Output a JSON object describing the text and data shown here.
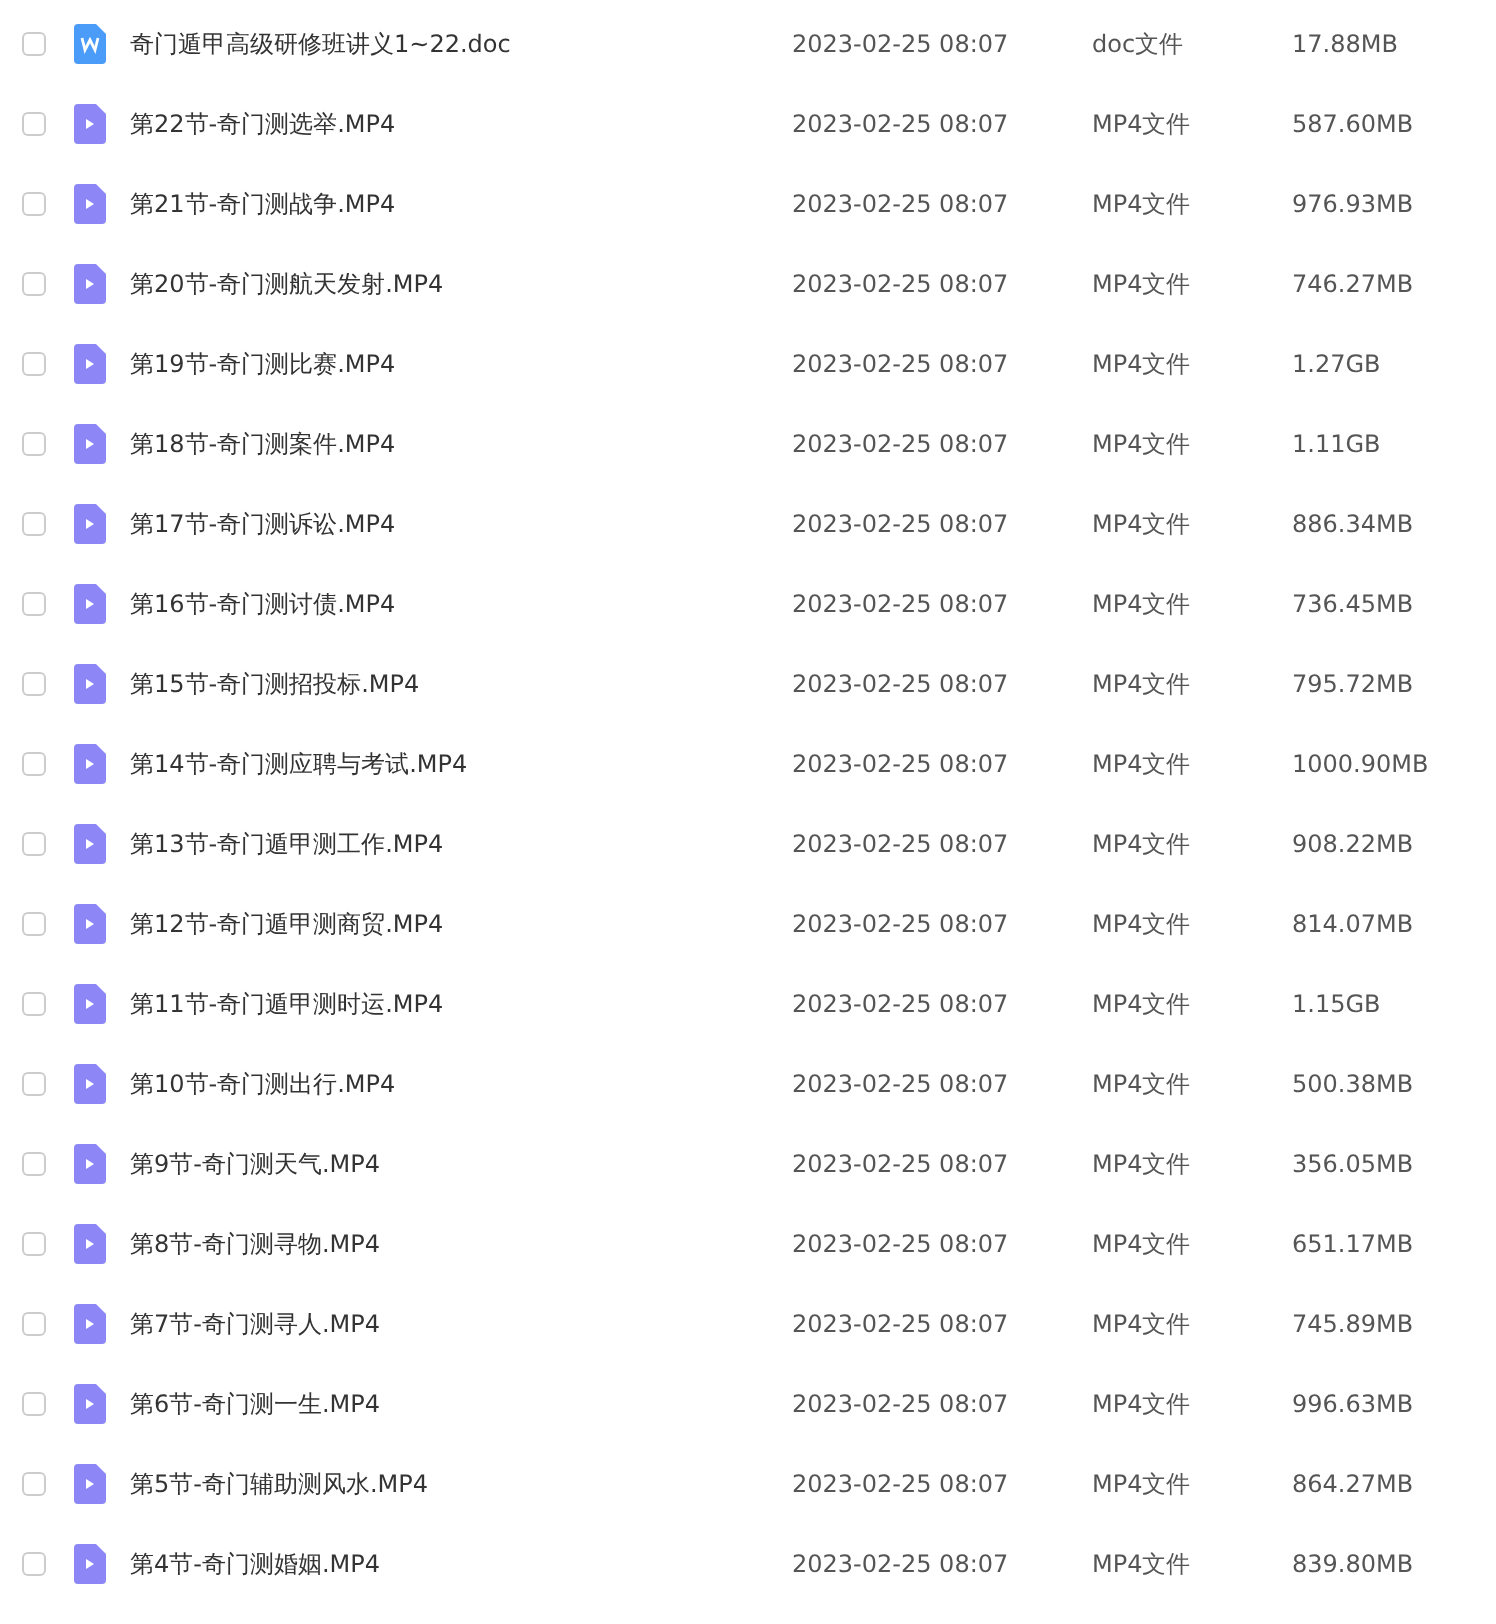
{
  "files": [
    {
      "kind": "doc",
      "name": "奇门遁甲高级研修班讲义1~22.doc",
      "date": "2023-02-25 08:07",
      "type": "doc文件",
      "size": "17.88MB",
      "checked": false
    },
    {
      "kind": "video",
      "name": "第22节-奇门测选举.MP4",
      "date": "2023-02-25 08:07",
      "type": "MP4文件",
      "size": "587.60MB",
      "checked": false
    },
    {
      "kind": "video",
      "name": "第21节-奇门测战争.MP4",
      "date": "2023-02-25 08:07",
      "type": "MP4文件",
      "size": "976.93MB",
      "checked": false
    },
    {
      "kind": "video",
      "name": "第20节-奇门测航天发射.MP4",
      "date": "2023-02-25 08:07",
      "type": "MP4文件",
      "size": "746.27MB",
      "checked": false
    },
    {
      "kind": "video",
      "name": "第19节-奇门测比赛.MP4",
      "date": "2023-02-25 08:07",
      "type": "MP4文件",
      "size": "1.27GB",
      "checked": false
    },
    {
      "kind": "video",
      "name": "第18节-奇门测案件.MP4",
      "date": "2023-02-25 08:07",
      "type": "MP4文件",
      "size": "1.11GB",
      "checked": false
    },
    {
      "kind": "video",
      "name": "第17节-奇门测诉讼.MP4",
      "date": "2023-02-25 08:07",
      "type": "MP4文件",
      "size": "886.34MB",
      "checked": false
    },
    {
      "kind": "video",
      "name": "第16节-奇门测讨债.MP4",
      "date": "2023-02-25 08:07",
      "type": "MP4文件",
      "size": "736.45MB",
      "checked": false
    },
    {
      "kind": "video",
      "name": "第15节-奇门测招投标.MP4",
      "date": "2023-02-25 08:07",
      "type": "MP4文件",
      "size": "795.72MB",
      "checked": false
    },
    {
      "kind": "video",
      "name": "第14节-奇门测应聘与考试.MP4",
      "date": "2023-02-25 08:07",
      "type": "MP4文件",
      "size": "1000.90MB",
      "checked": false
    },
    {
      "kind": "video",
      "name": "第13节-奇门遁甲测工作.MP4",
      "date": "2023-02-25 08:07",
      "type": "MP4文件",
      "size": "908.22MB",
      "checked": false
    },
    {
      "kind": "video",
      "name": "第12节-奇门遁甲测商贸.MP4",
      "date": "2023-02-25 08:07",
      "type": "MP4文件",
      "size": "814.07MB",
      "checked": false
    },
    {
      "kind": "video",
      "name": "第11节-奇门遁甲测时运.MP4",
      "date": "2023-02-25 08:07",
      "type": "MP4文件",
      "size": "1.15GB",
      "checked": false
    },
    {
      "kind": "video",
      "name": "第10节-奇门测出行.MP4",
      "date": "2023-02-25 08:07",
      "type": "MP4文件",
      "size": "500.38MB",
      "checked": false
    },
    {
      "kind": "video",
      "name": "第9节-奇门测天气.MP4",
      "date": "2023-02-25 08:07",
      "type": "MP4文件",
      "size": "356.05MB",
      "checked": false
    },
    {
      "kind": "video",
      "name": "第8节-奇门测寻物.MP4",
      "date": "2023-02-25 08:07",
      "type": "MP4文件",
      "size": "651.17MB",
      "checked": false
    },
    {
      "kind": "video",
      "name": "第7节-奇门测寻人.MP4",
      "date": "2023-02-25 08:07",
      "type": "MP4文件",
      "size": "745.89MB",
      "checked": false
    },
    {
      "kind": "video",
      "name": "第6节-奇门测一生.MP4",
      "date": "2023-02-25 08:07",
      "type": "MP4文件",
      "size": "996.63MB",
      "checked": false
    },
    {
      "kind": "video",
      "name": "第5节-奇门辅助测风水.MP4",
      "date": "2023-02-25 08:07",
      "type": "MP4文件",
      "size": "864.27MB",
      "checked": false
    },
    {
      "kind": "video",
      "name": "第4节-奇门测婚姻.MP4",
      "date": "2023-02-25 08:07",
      "type": "MP4文件",
      "size": "839.80MB",
      "checked": false
    }
  ]
}
